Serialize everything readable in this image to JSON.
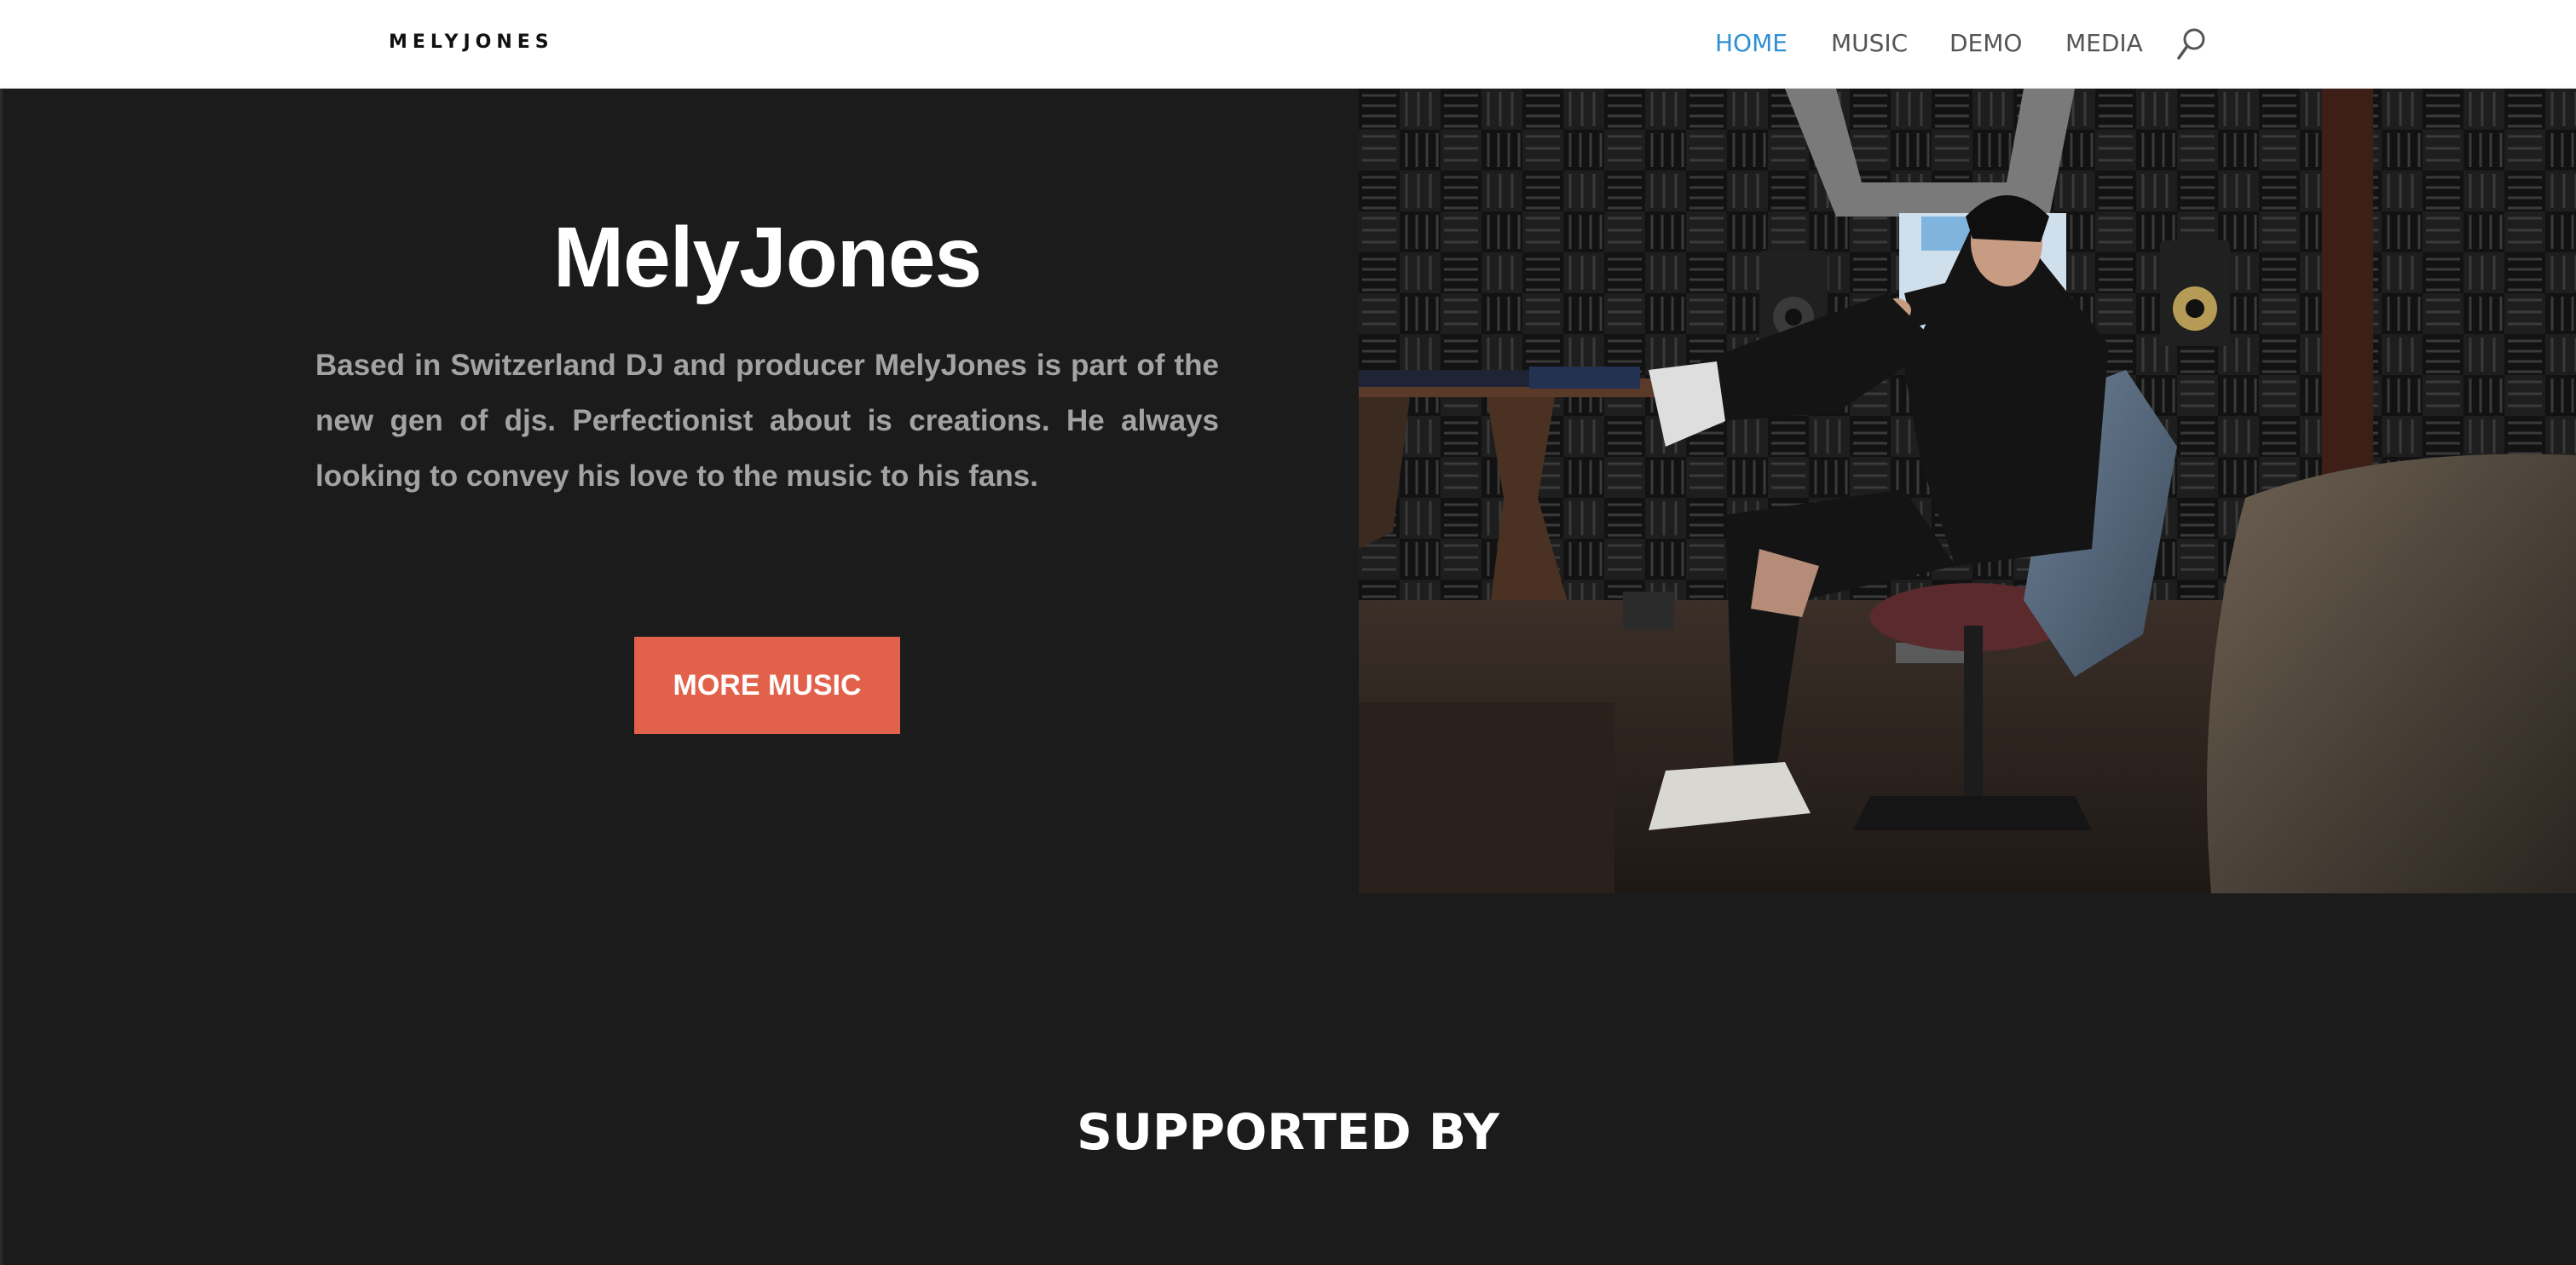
{
  "header": {
    "logo_text": "MELYJONES",
    "nav": [
      {
        "label": "HOME",
        "active": true
      },
      {
        "label": "MUSIC",
        "active": false
      },
      {
        "label": "DEMO",
        "active": false
      },
      {
        "label": "MEDIA",
        "active": false
      }
    ],
    "search_icon": "search-icon"
  },
  "hero": {
    "title": "MelyJones",
    "description": "Based in Switzerland DJ and producer MelyJones is part of the new gen of djs. Perfectionist about is creations. He always looking to convey his love to the music to his fans.",
    "cta_label": "MORE MUSIC",
    "photo_alt": "DJ seated in a studio chair with acoustic foam walls, monitors and speakers"
  },
  "supported": {
    "title": "SUPPORTED BY"
  },
  "colors": {
    "background": "#1b1b1b",
    "header_bg": "#ffffff",
    "nav_active": "#2e8fd6",
    "nav_text": "#555555",
    "accent": "#e2614a",
    "description_text": "#a3a3a3"
  }
}
